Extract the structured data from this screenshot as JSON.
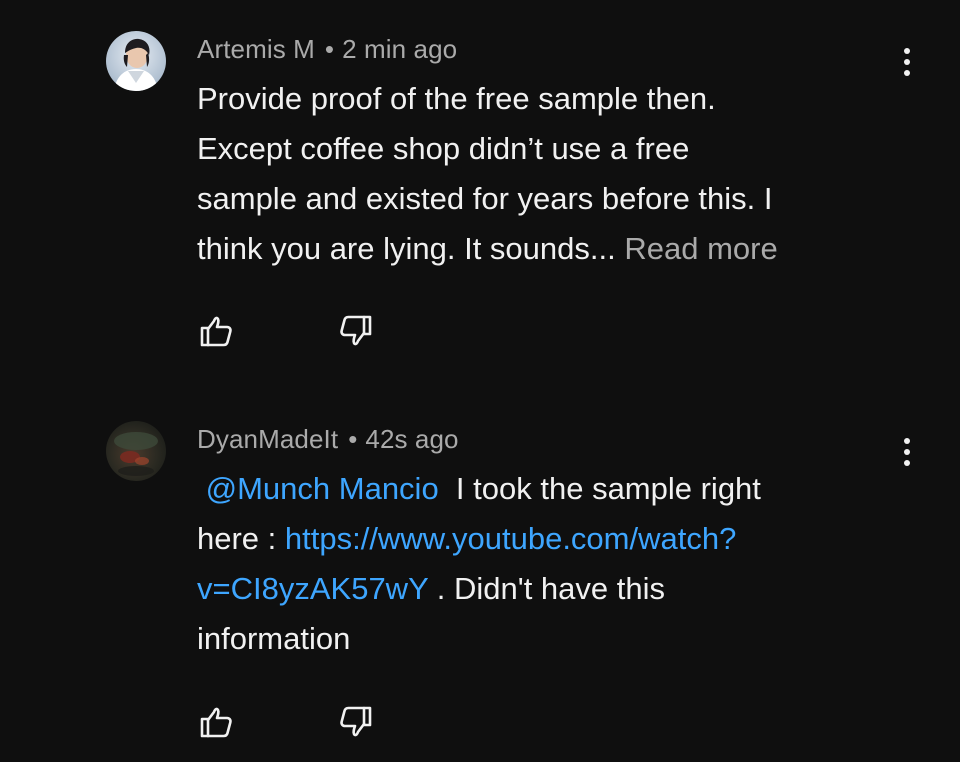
{
  "comments": [
    {
      "author": "Artemis M",
      "separator": "•",
      "time": "2 min ago",
      "lines": [
        "Provide proof of the free sample then.",
        "Except coffee shop didn’t use a free",
        "sample and existed for years before this. I",
        "think you are lying. It sounds..."
      ],
      "read_more": "Read more",
      "avatar_icon": "user-avatar-photo",
      "menu_icon": "more-vert-icon"
    },
    {
      "author": "DyanMadeIt",
      "separator": "•",
      "time": "42s ago",
      "mention": "@Munch Mancio",
      "line1_rest": " I took the sample right",
      "line2_prefix": "here : ",
      "link_part1": "https://www.youtube.com/watch?",
      "link_part2": "v=CI8yzAK57wY",
      "line3_rest": " . Didn't have this",
      "line4": "information",
      "avatar_icon": "user-avatar-photo",
      "menu_icon": "more-vert-icon"
    }
  ],
  "colors": {
    "background": "#0f0f0f",
    "text": "#f1f1f1",
    "meta": "#aaaaaa",
    "link": "#3ea6ff"
  },
  "icons": {
    "like": "thumbs-up-icon",
    "dislike": "thumbs-down-icon"
  }
}
